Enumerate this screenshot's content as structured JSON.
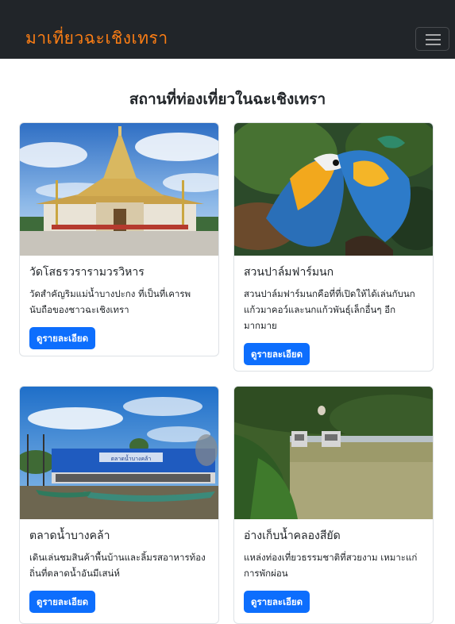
{
  "navbar": {
    "brand": "มาเที่ยวฉะเชิงเทรา"
  },
  "page": {
    "heading": "สถานที่ท่องเที่ยวในฉะเชิงเทรา"
  },
  "cards": [
    {
      "title": "วัดโสธรวรารามวรวิหาร",
      "text": "วัดสำคัญริมแม่น้ำบางปะกง ที่เป็นที่เคารพนับถือของชาวฉะเชิงเทรา",
      "button": "ดูรายละเอียด",
      "image": "temple-photo"
    },
    {
      "title": "สวนปาล์มฟาร์มนก",
      "text": "สวนปาล์มฟาร์มนกคือที่ที่เปิดให้ได้เล่นกับนกแก้วมาคอว์และนกแก้วพันธุ์เล็กอื่นๆ อีกมากมาย",
      "button": "ดูรายละเอียด",
      "image": "macaw-photo"
    },
    {
      "title": "ตลาดน้ำบางคล้า",
      "text": "เดินเล่นชมสินค้าพื้นบ้านและลิ้มรสอาหารท้องถิ่นที่ตลาดน้ำอันมีเสน่ห์",
      "button": "ดูรายละเอียด",
      "image": "floating-market-photo",
      "sign": "ตลาดน้ำบางคล้า"
    },
    {
      "title": "อ่างเก็บน้ำคลองสียัด",
      "text": "แหล่งท่องเที่ยวธรรมชาติที่สวยงาม เหมาะแก่การพักผ่อน",
      "button": "ดูรายละเอียด",
      "image": "reservoir-photo"
    }
  ]
}
